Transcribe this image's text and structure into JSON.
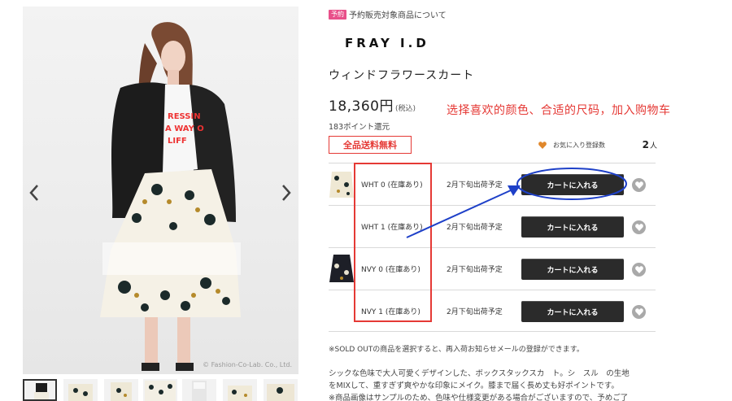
{
  "product_image": {
    "credit": "© Fashion-Co-Lab. Co., Ltd.",
    "slogan_lines": [
      "RESSIN",
      "A WAY O",
      "LIFF"
    ]
  },
  "gallery": {
    "prev_icon": "chevron-left-icon",
    "next_icon": "chevron-right-icon",
    "thumbnail_count": 8
  },
  "reserve": {
    "badge": "予約",
    "text": "予約販売対象商品について"
  },
  "brand": "FRAY I.D",
  "product": {
    "title": "ウィンドフラワースカート",
    "price": "18,360円",
    "tax_note": "(税込)",
    "points": "183ポイント還元",
    "free_shipping": "全品送料無料"
  },
  "annotation": {
    "note": "选择喜欢的颜色、合适的尺码，加入购物车"
  },
  "favorite": {
    "label": "お気に入り登録数",
    "count": "2",
    "unit": "人"
  },
  "variants": [
    {
      "name": "WHT 0 (在庫あり)",
      "ship": "2月下旬出荷予定",
      "button": "カートに入れる",
      "swatch": "white-floral"
    },
    {
      "name": "WHT 1 (在庫あり)",
      "ship": "2月下旬出荷予定",
      "button": "カートに入れる",
      "swatch": ""
    },
    {
      "name": "NVY 0 (在庫あり)",
      "ship": "2月下旬出荷予定",
      "button": "カートに入れる",
      "swatch": "navy-floral"
    },
    {
      "name": "NVY 1 (在庫あり)",
      "ship": "2月下旬出荷予定",
      "button": "カートに入れる",
      "swatch": ""
    }
  ],
  "soldout_note": "※SOLD OUTの商品を選択すると、再入荷お知らせメールの登録ができます。",
  "description": [
    "シックな色味で大人可愛くデザインした、ボックスタックスカ　ト。シ　スル　の生地",
    "をMIXして、重すぎず爽やかな印象にメイク。膝まで届く長め丈も好ポイントです。",
    "※商品画像はサンプルのため、色味や仕様変更がある場合がございますので、予めご了"
  ],
  "colors": {
    "accent_red": "#e53935",
    "annotation_blue": "#1e40c8",
    "reserve_pink": "#e8508a",
    "button_dark": "#2b2b2b"
  }
}
